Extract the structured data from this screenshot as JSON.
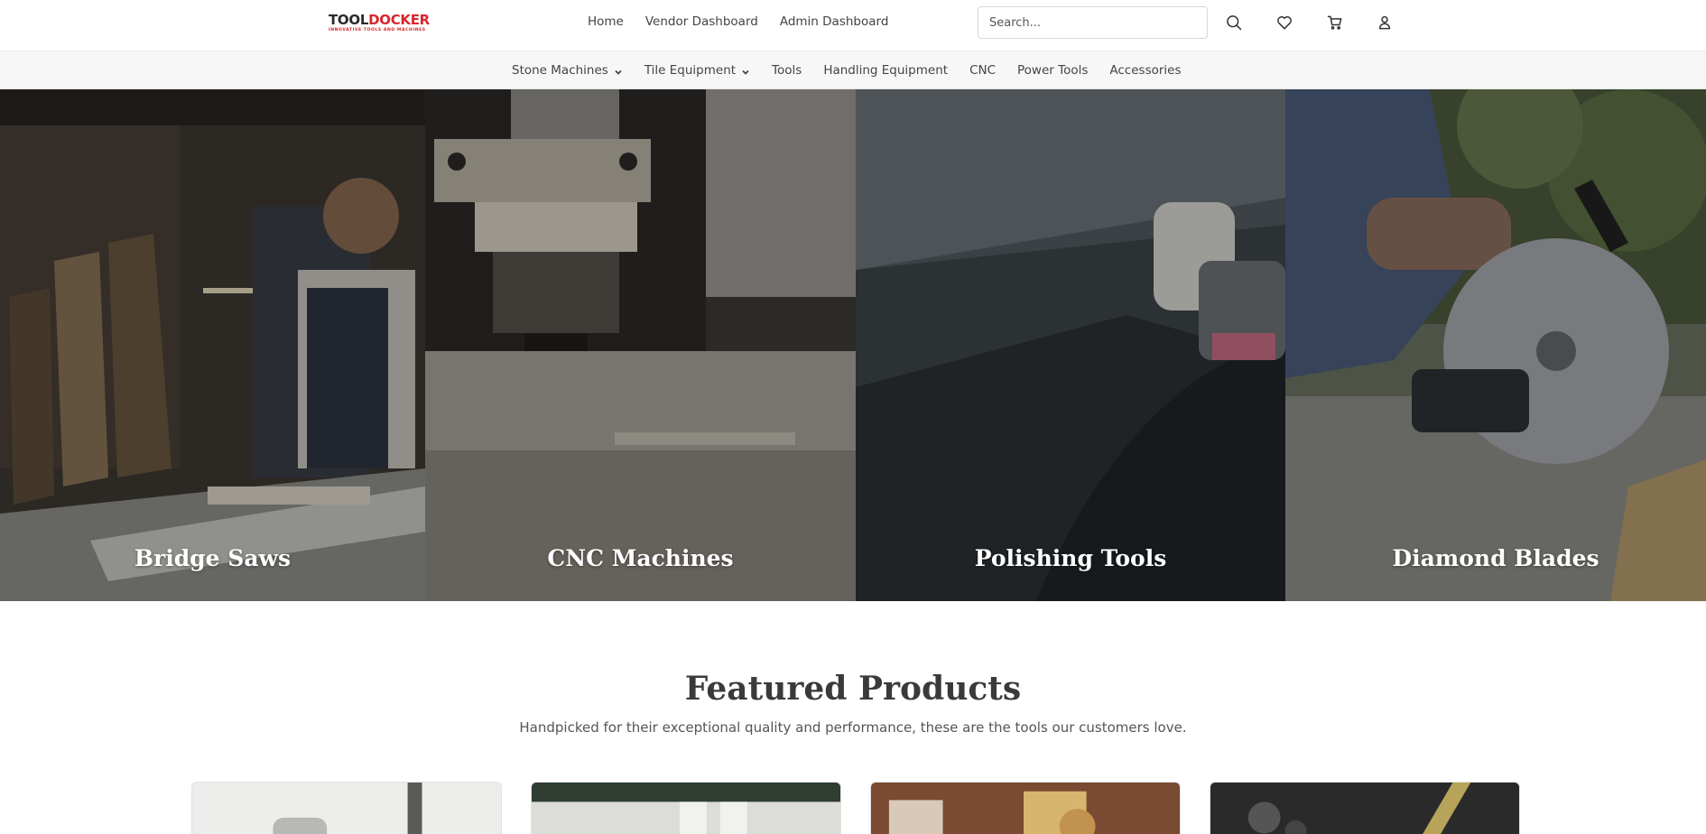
{
  "brand": {
    "name_part1": "TOOL",
    "name_part2": "DOCKER",
    "tagline": "INNOVATIVE TOOLS AND MACHINES"
  },
  "header": {
    "nav": [
      "Home",
      "Vendor Dashboard",
      "Admin Dashboard"
    ],
    "search_placeholder": "Search...",
    "icons": [
      "search-icon",
      "heart-icon",
      "cart-icon",
      "user-icon"
    ]
  },
  "categories": [
    {
      "label": "Stone Machines",
      "has_dropdown": true
    },
    {
      "label": "Tile Equipment",
      "has_dropdown": true
    },
    {
      "label": "Tools",
      "has_dropdown": false
    },
    {
      "label": "Handling Equipment",
      "has_dropdown": false
    },
    {
      "label": "CNC",
      "has_dropdown": false
    },
    {
      "label": "Power Tools",
      "has_dropdown": false
    },
    {
      "label": "Accessories",
      "has_dropdown": false
    }
  ],
  "hero_tiles": [
    {
      "label": "Bridge Saws"
    },
    {
      "label": "CNC Machines"
    },
    {
      "label": "Polishing Tools"
    },
    {
      "label": "Diamond Blades"
    }
  ],
  "featured": {
    "title": "Featured Products",
    "subtitle": "Handpicked for their exceptional quality and performance, these are the tools our customers love."
  },
  "colors": {
    "brand_red": "#d9252c",
    "text_dark": "#3a3a3a",
    "nav_bg": "#f7f7f7"
  }
}
